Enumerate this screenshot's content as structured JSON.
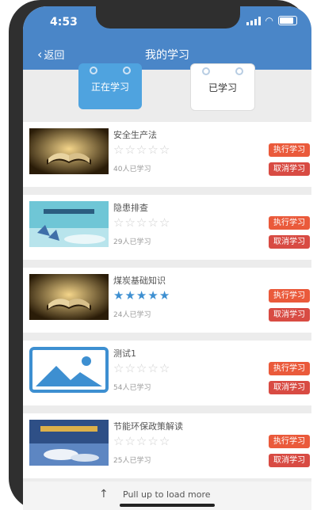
{
  "status_bar": {
    "time": "4:53"
  },
  "nav": {
    "back_label": "返回",
    "title": "我的学习"
  },
  "tabs": [
    {
      "label": "正在学习",
      "active": true
    },
    {
      "label": "已学习",
      "active": false
    }
  ],
  "courses": [
    {
      "title": "安全生产法",
      "rating": 0,
      "learners": "40人已学习",
      "image": "book-photo"
    },
    {
      "title": "隐患排查",
      "rating": 0,
      "learners": "29人已学习",
      "image": "blue-banner"
    },
    {
      "title": "煤炭基础知识",
      "rating": 5,
      "learners": "24人已学习",
      "image": "book-photo"
    },
    {
      "title": "测试1",
      "rating": 0,
      "learners": "54人已学习",
      "image": "image-placeholder"
    },
    {
      "title": "节能环保政策解读",
      "rating": 0,
      "learners": "25人已学习",
      "image": "landscape-photo"
    }
  ],
  "actions": {
    "execute_label": "执行学习",
    "cancel_label": "取消学习"
  },
  "footer": {
    "pull_text": "Pull up to load more"
  },
  "colors": {
    "header": "#4a86c8",
    "active_tab": "#4fa3df",
    "star_on": "#3d8fd1",
    "button": "#e1523d"
  }
}
